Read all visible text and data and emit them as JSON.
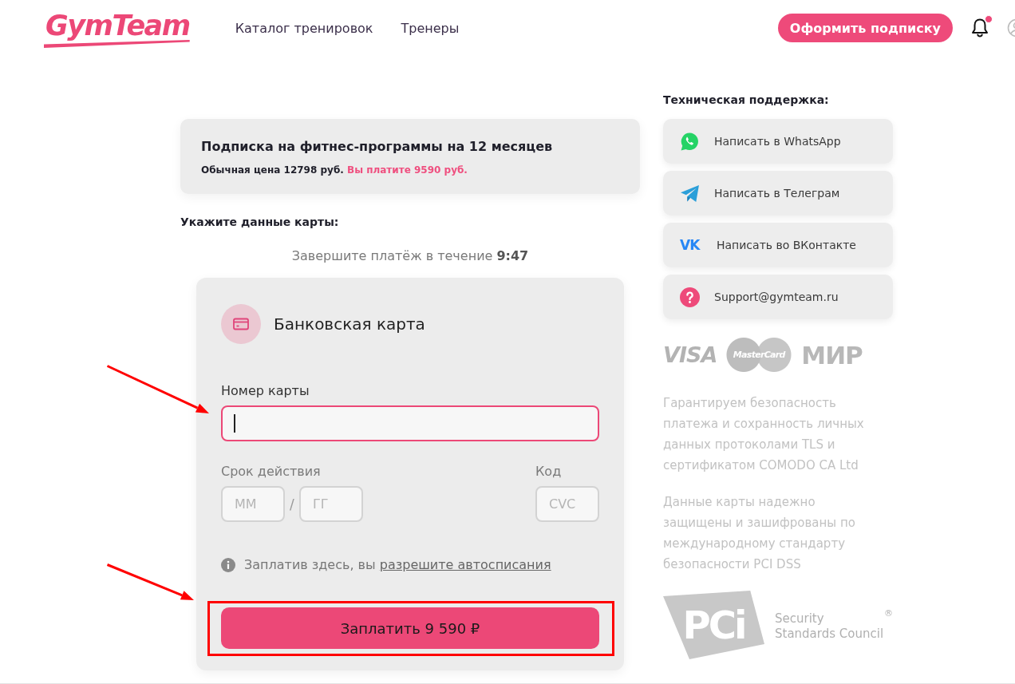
{
  "header": {
    "logo": "GymTeam",
    "nav": [
      {
        "label": "Каталог тренировок"
      },
      {
        "label": "Тренеры"
      }
    ],
    "subscribe_button": "Оформить подписку",
    "notifications": {
      "unread": true
    }
  },
  "summary": {
    "title": "Подписка на фитнес-программы на 12 месяцев",
    "regular_price": "Обычная цена 12798 руб.",
    "offer_price": "Вы платите 9590 руб."
  },
  "card_heading": "Укажите данные карты:",
  "timer": "Завершите платёж в течение **9:47**",
  "payment_form": {
    "method": "Банковская карта",
    "card_number": {
      "label": "Номер карты",
      "focused": true,
      "pointer_arrow": true
    },
    "expiry": {
      "label": "Срок действия",
      "month_placeholder": "ММ",
      "separator": "/",
      "year_placeholder": "ГГ"
    },
    "code": {
      "label": "Код",
      "placeholder": "CVC"
    },
    "notice": {
      "text": "Заплатив здесь, вы",
      "link": "разрешите автосписания"
    },
    "pay_button": {
      "label": "Заплатить 9 590 ₽",
      "highlight_frame": true,
      "pointer_arrow": true
    }
  },
  "support": {
    "title": "Техническая поддержка:",
    "items": [
      {
        "kind": "whatsapp",
        "label": "Написать в WhatsApp"
      },
      {
        "kind": "telegram",
        "label": "Написать в Телеграм"
      },
      {
        "kind": "vk",
        "logo_text": "VK",
        "label": "Написать во ВКонтакте"
      },
      {
        "kind": "email",
        "label": "Support@gymteam.ru"
      }
    ]
  },
  "payment_logos": [
    {
      "kind": "visa",
      "text": "VISA"
    },
    {
      "kind": "mastercard",
      "text": "MasterCard"
    },
    {
      "kind": "mir",
      "text": "МИР"
    }
  ],
  "security_notes": [
    "Гарантируем безопасность платежа и сохранность личных данных протоколами TLS и сертификатом COMODO CA Ltd",
    "Данные карты надежно защищены и зашифрованы по международному стандарту безопасности PCI DSS"
  ],
  "pci": {
    "mark": "PCi",
    "caption": [
      "Security",
      "Standards Council"
    ],
    "registered": "®"
  }
}
